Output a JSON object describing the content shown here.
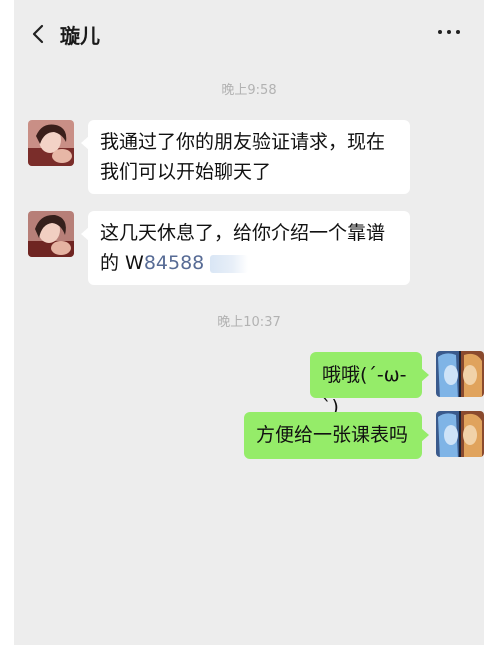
{
  "header": {
    "title": "璇儿",
    "back_icon": "chevron-left-icon",
    "more_icon": "more-dots-icon"
  },
  "messages": [
    {
      "type": "time",
      "text": "晚上9:58"
    },
    {
      "type": "incoming",
      "lines": [
        "我通过了你的朋友验证请求，现在",
        "我们可以开始聊天了"
      ]
    },
    {
      "type": "incoming",
      "line1": "这几天休息了，给你介绍一个靠谱",
      "line2_prefix": "的 W",
      "line2_link": "84588"
    },
    {
      "type": "time",
      "text": "晚上10:37"
    },
    {
      "type": "outgoing",
      "text": "哦哦(´-ω-`)"
    },
    {
      "type": "outgoing",
      "text": "方便给一张课表吗"
    }
  ],
  "colors": {
    "background": "#ededed",
    "incoming_bubble": "#ffffff",
    "outgoing_bubble": "#95ec69",
    "link": "#576b95",
    "timestamp": "#b2b2b2"
  }
}
